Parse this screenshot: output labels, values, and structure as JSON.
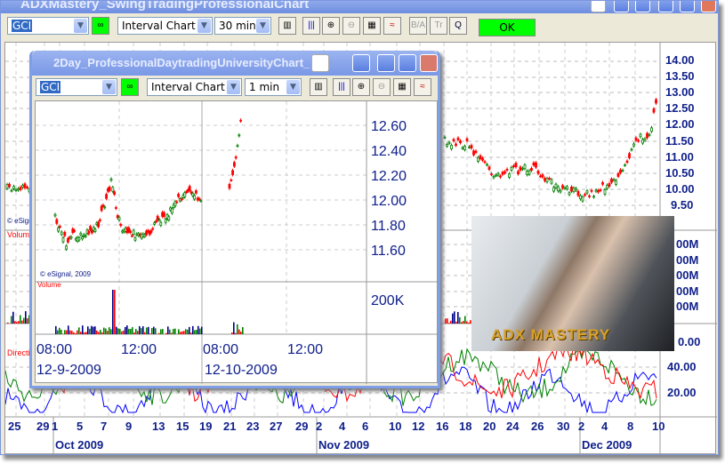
{
  "main": {
    "title": "ADXMastery_SwingTradingProfessionalChart",
    "symbol": "GCI",
    "chart_type": "Interval Chart",
    "interval": "30 min",
    "ok_label": "OK",
    "price_labels": [
      "14.00",
      "13.50",
      "13.00",
      "12.50",
      "12.00",
      "11.50",
      "11.00",
      "10.50",
      "10.00",
      "9.50"
    ],
    "volume_labels": [
      "00M",
      "00M",
      "00M",
      "00M",
      "00M"
    ],
    "direction_labels": [
      "0.00",
      "40.00",
      "20.00"
    ],
    "pane_labels": {
      "esignal": "© eSignal",
      "volume": "Volume",
      "direction": "Direction"
    },
    "day_labels": [
      "25",
      "29",
      "1",
      "5",
      "7",
      "9",
      "13",
      "15",
      "19",
      "21",
      "23",
      "27",
      "29",
      "2",
      "4",
      "6",
      "10",
      "12",
      "16",
      "18",
      "20",
      "24",
      "26",
      "30",
      "2",
      "4",
      "8",
      "10"
    ],
    "month_labels": [
      "Oct 2009",
      "Nov 2009",
      "Dec 2009"
    ]
  },
  "inner": {
    "title": "2Day_ProfessionalDaytradingUniversityChart_",
    "symbol": "GCI",
    "chart_type": "Interval Chart",
    "interval": "1 min",
    "price_labels": [
      "12.60",
      "12.40",
      "12.20",
      "12.00",
      "11.80",
      "11.60"
    ],
    "volume_label": "200K",
    "esignal": "© eSignal, 2009",
    "volume": "Volume",
    "time_labels": [
      "08:00",
      "12:00",
      "08:00",
      "12:00"
    ],
    "date_labels": [
      "12-9-2009",
      "12-10-2009"
    ]
  },
  "banner": {
    "text": "ADX MASTERY"
  },
  "colors": {
    "up": "#008000",
    "down": "#ff0000",
    "axis": "#10208a",
    "ok": "#00ff00",
    "titlebar": "#7a98e6"
  }
}
